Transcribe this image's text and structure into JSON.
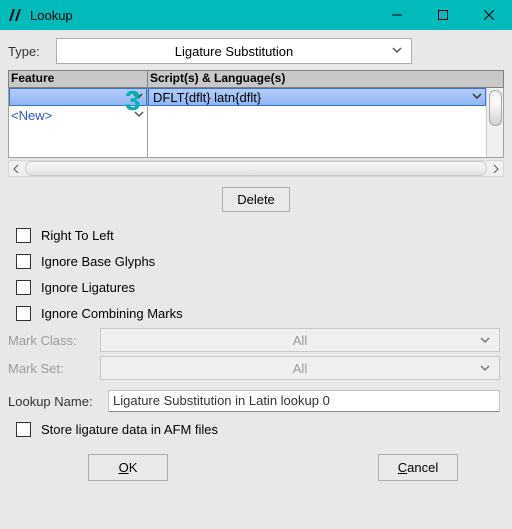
{
  "titlebar": {
    "title": "Lookup"
  },
  "type": {
    "label": "Type:",
    "value": "Ligature Substitution"
  },
  "badge": "3",
  "headers": {
    "feature": "Feature",
    "scripts": "Script(s) & Language(s)"
  },
  "feature": {
    "new_row": "<New>"
  },
  "scripts": {
    "row": "DFLT{dflt} latn{dflt}"
  },
  "buttons": {
    "delete": "Delete",
    "ok": "OK",
    "cancel": "Cancel"
  },
  "checks": {
    "rtl": "Right To Left",
    "ignore_base": "Ignore Base Glyphs",
    "ignore_lig": "Ignore Ligatures",
    "ignore_comb": "Ignore Combining Marks"
  },
  "mark_class": {
    "label": "Mark Class:",
    "value": "All"
  },
  "mark_set": {
    "label": "Mark Set:",
    "value": "All"
  },
  "lookup": {
    "label": "Lookup Name:",
    "value": "Ligature Substitution in Latin lookup 0"
  },
  "store_afm": {
    "label": "Store ligature data in AFM files"
  }
}
